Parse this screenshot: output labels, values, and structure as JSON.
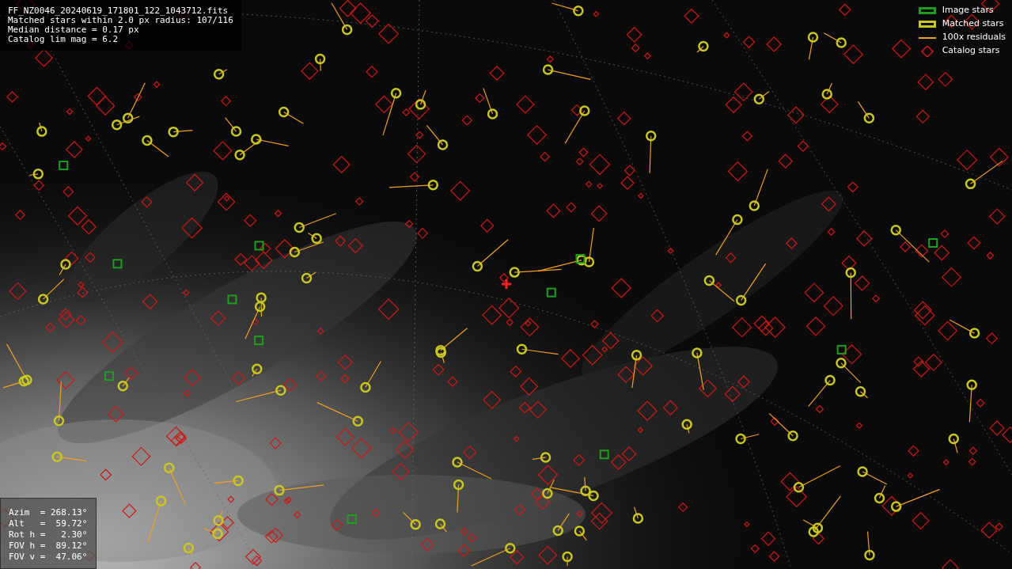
{
  "info_box": {
    "lines": [
      "FF_NZ0046_20240619_171801_122_1043712.fits",
      "Matched stars within 2.0 px radius: 107/116",
      "Median distance = 0.17 px",
      "Catalog lim mag = 6.2"
    ]
  },
  "legend": [
    {
      "kind": "box",
      "label": "Image stars",
      "color": "#1e9e1e"
    },
    {
      "kind": "box",
      "label": "Matched stars",
      "color": "#c8c81e"
    },
    {
      "kind": "line",
      "label": "100x residuals",
      "color": "#f0a020"
    },
    {
      "kind": "diamond",
      "label": "Catalog stars",
      "color": "#d01818"
    }
  ],
  "pointing_box": {
    "lines": [
      "Azim  = 268.13°",
      "Alt   =  59.72°",
      "Rot h =   2.30°",
      "FOV h =  89.12°",
      "FOV v =  47.06°"
    ]
  }
}
